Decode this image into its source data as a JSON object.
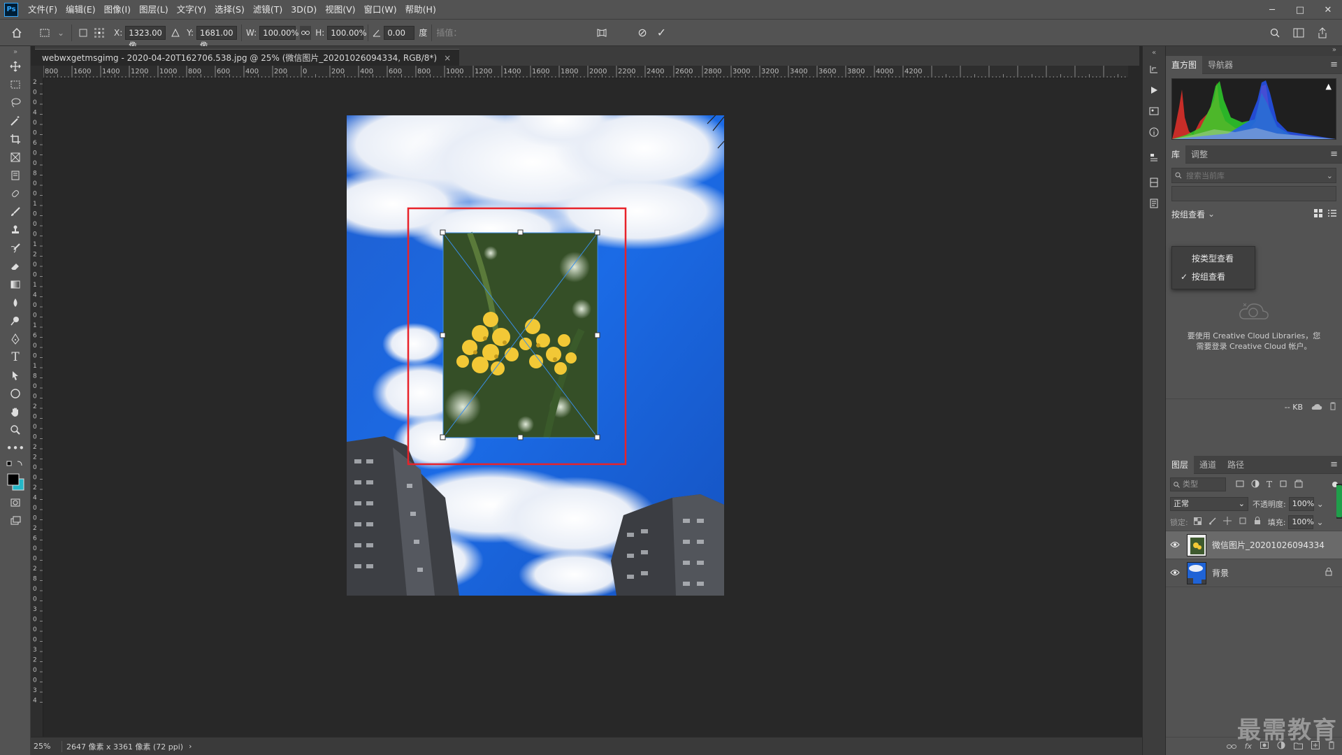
{
  "app": {
    "logo": "Ps"
  },
  "menu": [
    "文件(F)",
    "编辑(E)",
    "图像(I)",
    "图层(L)",
    "文字(Y)",
    "选择(S)",
    "滤镜(T)",
    "3D(D)",
    "视图(V)",
    "窗口(W)",
    "帮助(H)"
  ],
  "window_controls": {
    "minimize": "─",
    "maximize": "□",
    "close": "✕"
  },
  "options": {
    "x_label": "X:",
    "x_value": "1323.00 像",
    "y_label": "Y:",
    "y_value": "1681.00 像",
    "w_label": "W:",
    "w_value": "100.00%",
    "h_label": "H:",
    "h_value": "100.00%",
    "angle_value": "0.00",
    "angle_unit": "度",
    "interp_label": "插值：",
    "warp_label": "变形",
    "cancel": "⊘",
    "commit": "✓"
  },
  "document_tab": {
    "title": "webwxgetmsgimg - 2020-04-20T162706.538.jpg @ 25% (微信图片_20201026094334, RGB/8*)",
    "close": "×"
  },
  "ruler_h": [
    "800",
    "1600",
    "1400",
    "1200",
    "1000",
    "800",
    "600",
    "400",
    "200",
    "0",
    "200",
    "400",
    "600",
    "800",
    "1000",
    "1200",
    "1400",
    "1600",
    "1800",
    "2000",
    "2200",
    "2400",
    "2600",
    "2800",
    "3000",
    "3200",
    "3400",
    "3600",
    "3800",
    "4000",
    "4200"
  ],
  "ruler_v": [
    "2",
    "0",
    "0",
    "4",
    "0",
    "0",
    "6",
    "0",
    "0",
    "8",
    "0",
    "0",
    "1",
    "0",
    "0",
    "0",
    "1",
    "2",
    "0",
    "0",
    "1",
    "4",
    "0",
    "0",
    "1",
    "6",
    "0",
    "0",
    "1",
    "8",
    "0",
    "0",
    "2",
    "0",
    "0",
    "0",
    "2",
    "2",
    "0",
    "0",
    "2",
    "4",
    "0",
    "0",
    "2",
    "6",
    "0",
    "0",
    "2",
    "8",
    "0",
    "0",
    "3",
    "0",
    "0",
    "0",
    "3",
    "2",
    "0",
    "0",
    "3",
    "4"
  ],
  "status": {
    "zoom": "25%",
    "info": "2647 像素 x 3361 像素 (72 ppi)",
    "arrow": "›"
  },
  "panels": {
    "histogram_tabs": [
      "直方图",
      "导航器"
    ],
    "library_tabs": [
      "库",
      "调整"
    ],
    "library_search_placeholder": "搜索当前库",
    "view_by": "按组查看",
    "dropdown_items": [
      "按类型查看",
      "按组查看"
    ],
    "dropdown_checked": 1,
    "cc_message_line1": "要使用 Creative Cloud Libraries，您",
    "cc_message_line2": "需要登录 Creative Cloud 帐户。",
    "kb_label": "-- KB",
    "layers_tabs": [
      "图层",
      "通道",
      "路径"
    ],
    "layer_filter": "类型",
    "blend_mode": "正常",
    "opacity_label": "不透明度:",
    "opacity_value": "100%",
    "lock_label": "锁定:",
    "fill_label": "填充:",
    "fill_value": "100%",
    "layers": [
      {
        "name": "微信图片_20201026094334",
        "selected": true
      },
      {
        "name": "背景",
        "selected": false,
        "locked": true
      }
    ]
  },
  "watermark": "最需教育",
  "colors": {
    "selection_red": "#e8232a",
    "sky_blue": "#1d63d6",
    "accent_blue": "#31a8ff"
  }
}
